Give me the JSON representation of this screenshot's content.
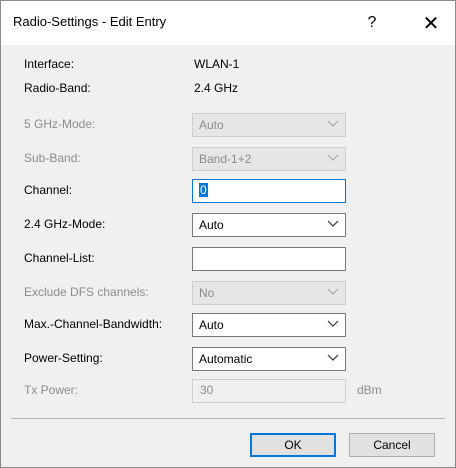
{
  "window": {
    "title": "Radio-Settings - Edit Entry",
    "help_glyph": "?",
    "close_glyph": "✕"
  },
  "fields": {
    "interface": {
      "label": "Interface:",
      "value": "WLAN-1"
    },
    "radio_band": {
      "label": "Radio-Band:",
      "value": "2.4 GHz"
    },
    "ghz5_mode": {
      "label": "5 GHz-Mode:",
      "value": "Auto",
      "enabled": false
    },
    "sub_band": {
      "label": "Sub-Band:",
      "value": "Band-1+2",
      "enabled": false
    },
    "channel": {
      "label": "Channel:",
      "value": "0",
      "focused": true
    },
    "ghz24_mode": {
      "label": "2.4 GHz-Mode:",
      "value": "Auto"
    },
    "channel_list": {
      "label": "Channel-List:",
      "value": ""
    },
    "exclude_dfs": {
      "label": "Exclude DFS channels:",
      "value": "No",
      "enabled": false
    },
    "max_bandwidth": {
      "label": "Max.-Channel-Bandwidth:",
      "value": "Auto"
    },
    "power_setting": {
      "label": "Power-Setting:",
      "value": "Automatic"
    },
    "tx_power": {
      "label": "Tx Power:",
      "value": "30",
      "unit": "dBm",
      "enabled": false
    }
  },
  "buttons": {
    "ok": "OK",
    "cancel": "Cancel"
  },
  "icons": {
    "dropdown": "chevron-down-icon",
    "help": "help-icon",
    "close": "close-icon"
  }
}
